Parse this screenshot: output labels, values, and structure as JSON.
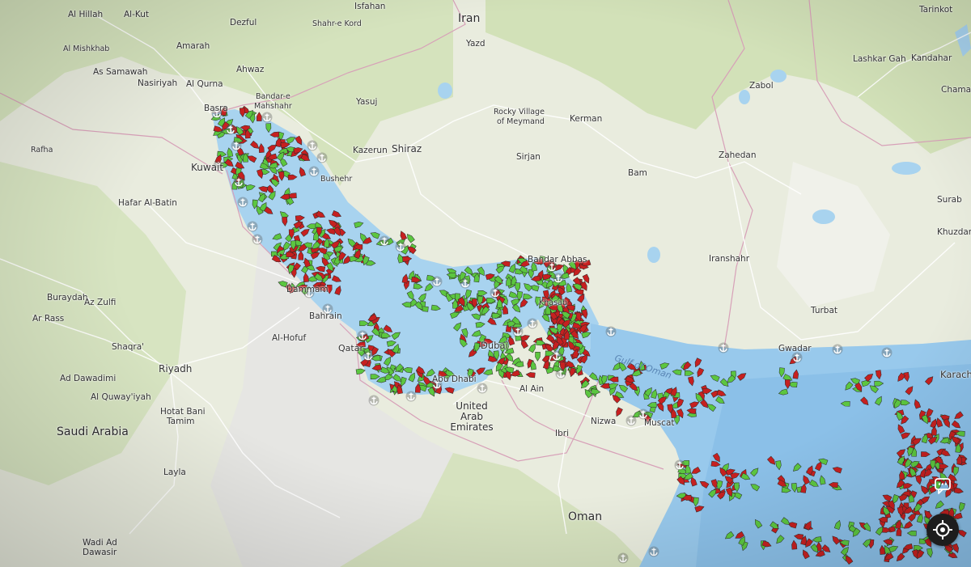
{
  "map": {
    "labels": {
      "iran": "Iran",
      "saudi_arabia": "Saudi Arabia",
      "uae": "United Arab Emirates",
      "oman": "Oman",
      "kuwait": "Kuwait",
      "qatar": "Qatar",
      "bahrain": "Bahrain",
      "al_hillah": "Al Hillah",
      "al_kut": "Al-Kut",
      "dezful": "Dezful",
      "isfahan": "Isfahan",
      "shahr_e_kord": "Shahr-e Kord",
      "amarah": "Amarah",
      "al_mishkhab": "Al Mishkhab",
      "as_samawah": "As Samawah",
      "nasiriyah": "Nasiriyah",
      "al_qurna": "Al Qurna",
      "ahwaz": "Ahwaz",
      "bandar_e_mahshahr_1": "Bandar-e",
      "bandar_e_mahshahr_2": "Mahshahr",
      "basra": "Basra",
      "yasuj": "Yasuj",
      "yazd": "Yazd",
      "rocky_village_1": "Rocky Village",
      "rocky_village_2": "of Meymand",
      "kerman": "Kerman",
      "kazerun": "Kazerun",
      "shiraz": "Shiraz",
      "bushehr": "Bushehr",
      "sirjan": "Sirjan",
      "bam": "Bam",
      "zabol": "Zabol",
      "zahedan": "Zahedan",
      "tarinkot": "Tarinkot",
      "lashkar_gah": "Lashkar Gah",
      "kandahar": "Kandahar",
      "chaman": "Chaman",
      "rafha": "Rafha",
      "hafar_al_batin": "Hafar Al-Batin",
      "buraydah": "Buraydah",
      "az_zulfi": "Az Zulfi",
      "ar_rass": "Ar Rass",
      "shaqra": "Shaqra'",
      "ad_dawadimi": "Ad Dawadimi",
      "riyadh": "Riyadh",
      "al_quwayiyah": "Al Quway'iyah",
      "hotat_bani_1": "Hotat Bani",
      "hotat_bani_2": "Tamim",
      "layla": "Layla",
      "wadi_ad_1": "Wadi Ad",
      "wadi_ad_2": "Dawasir",
      "dammam": "Dammam",
      "al_hofuf": "Al-Hofuf",
      "dubai": "Dubai",
      "abu_dhabi": "Abu Dhabi",
      "al_ain": "Al Ain",
      "ibri": "Ibri",
      "nizwa": "Nizwa",
      "muscat": "Muscat",
      "bandar_abbas": "Bandar Abbas",
      "khasab": "Khasab",
      "iranshahr": "Iranshahr",
      "turbat": "Turbat",
      "gwadar": "Gwadar",
      "surab": "Surab",
      "khuzdar": "Khuzdar",
      "karachi": "Karachi",
      "gulf_of_oman": "Gulf of Oman"
    }
  },
  "controls": {
    "chat_icon": "chat-bubble-icon",
    "locate_icon": "crosshair-locate-icon"
  },
  "colors": {
    "land": "#e7ecd9",
    "green_land": "#cfe0b2",
    "water": "#a9d3ee",
    "deep_water": "#8cc3ea",
    "ship_green": "#5cc640",
    "ship_red": "#c62020",
    "anchor": "#ffffff",
    "locate_button": "#1d1d1d"
  }
}
